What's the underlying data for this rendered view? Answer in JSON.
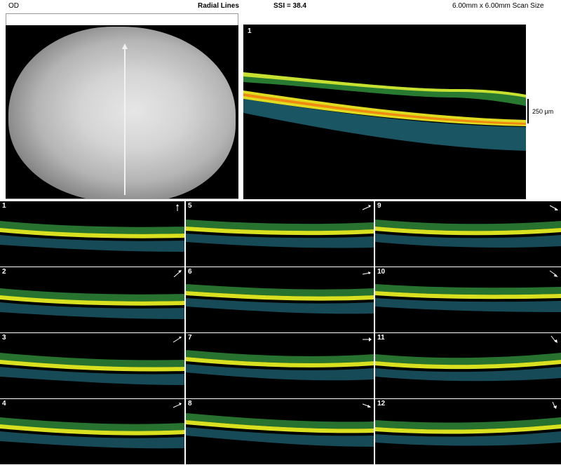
{
  "header": {
    "eye": "OD",
    "protocol": "Radial Lines",
    "ssi": "SSI = 38.4",
    "scan_size": "6.00mm x 6.00mm Scan Size"
  },
  "main_scan": {
    "number": "1",
    "scale_label": "250 µm"
  },
  "thumbnails": [
    {
      "number": "1"
    },
    {
      "number": "2"
    },
    {
      "number": "3"
    },
    {
      "number": "4"
    },
    {
      "number": "5"
    },
    {
      "number": "6"
    },
    {
      "number": "7"
    },
    {
      "number": "8"
    },
    {
      "number": "9"
    },
    {
      "number": "10"
    },
    {
      "number": "11"
    },
    {
      "number": "12"
    }
  ]
}
